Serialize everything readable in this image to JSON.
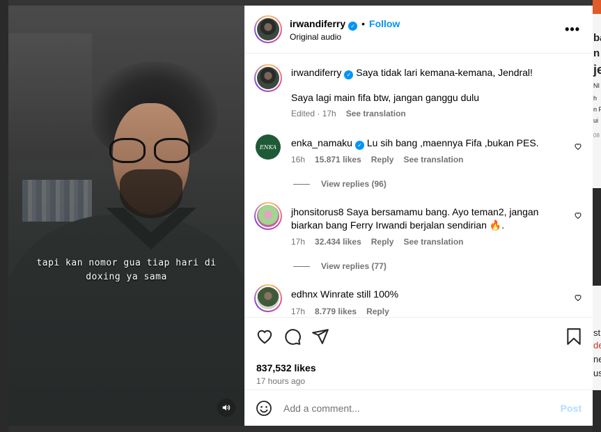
{
  "post": {
    "author": "irwandiferry",
    "follow_label": "Follow",
    "dot": "•",
    "audio": "Original audio",
    "more_label": "•••"
  },
  "video": {
    "caption_line1": "tapi kan nomor gua tiap hari di",
    "caption_line2": "doxing ya sama",
    "mute_icon": "speaker-icon"
  },
  "caption": {
    "username": "irwandiferry",
    "text_line1": "Saya tidak lari kemana-kemana, Jendral!",
    "text_line2": "Saya lagi main fifa btw, jangan ganggu dulu",
    "edited": "Edited · 17h",
    "see_translation": "See translation"
  },
  "comments": [
    {
      "username": "enka_namaku",
      "verified": true,
      "text": "Lu sih bang ,maennya Fifa ,bukan PES.",
      "time": "16h",
      "likes": "15.871 likes",
      "reply": "Reply",
      "see_translation": "See translation",
      "view_replies": "View replies (96)",
      "avatar_text": "ENKA"
    },
    {
      "username": "jhonsitorus8",
      "verified": false,
      "text_line1": "Saya bersamamu bang. Ayo teman2, jangan",
      "text_line2": "biarkan bang Ferry Irwandi berjalan sendirian 🔥.",
      "time": "17h",
      "likes": "32.434 likes",
      "reply": "Reply",
      "see_translation": "See translation",
      "view_replies": "View replies (77)"
    },
    {
      "username": "edhnx",
      "verified": false,
      "text": "Winrate still 100%",
      "time": "17h",
      "likes": "8.779 likes",
      "reply": "Reply"
    }
  ],
  "stats": {
    "likes": "837,532 likes",
    "ago": "17 hours ago"
  },
  "composer": {
    "placeholder": "Add a comment...",
    "post_label": "Post"
  },
  "background": {
    "right_fragments": [
      "ba",
      "n",
      "je",
      "NI",
      "h",
      "n F",
      "ui",
      "08",
      "st",
      "de",
      "ne",
      "us"
    ]
  },
  "colors": {
    "accent": "#0095f6",
    "muted": "#737373",
    "post_disabled": "#b3dbff"
  }
}
